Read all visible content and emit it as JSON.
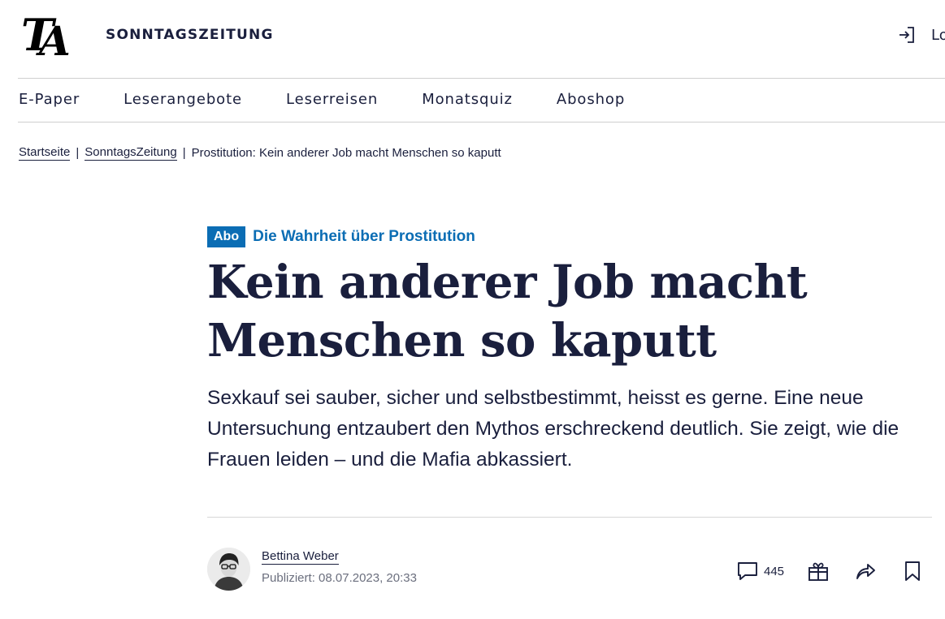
{
  "header": {
    "logo_text": "TA",
    "site_name": "SONNTAGSZEITUNG",
    "login_label": "Login"
  },
  "nav": {
    "items": [
      "E-Paper",
      "Leserangebote",
      "Leserreisen",
      "Monatsquiz",
      "Aboshop"
    ]
  },
  "breadcrumb": {
    "items": [
      "Startseite",
      "SonntagsZeitung",
      "Prostitution: Kein anderer Job macht Menschen so kaputt"
    ],
    "separator": "|"
  },
  "article": {
    "badge": "Abo",
    "kicker": "Die Wahrheit über Prostitution",
    "headline_line1": "Kein anderer Job macht",
    "headline_line2": "Menschen so kaputt",
    "lead": "Sexkauf sei sauber, sicher und selbstbestimmt, heisst es gerne. Eine neue Untersuchung entzaubert den Mythos erschreckend deutlich. Sie zeigt, wie die Frauen leiden – und die Mafia abkassiert.",
    "author": "Bettina Weber",
    "published": "Publiziert: 08.07.2023, 20:33",
    "comment_count": "445"
  },
  "icons": {
    "login": "login-icon",
    "comments": "comment-icon",
    "gift": "gift-icon",
    "share": "share-icon",
    "bookmark": "bookmark-icon"
  },
  "colors": {
    "text": "#1a1f3d",
    "accent": "#0b6db4",
    "muted": "#6b6f7e",
    "rule": "#cfcfcf"
  }
}
